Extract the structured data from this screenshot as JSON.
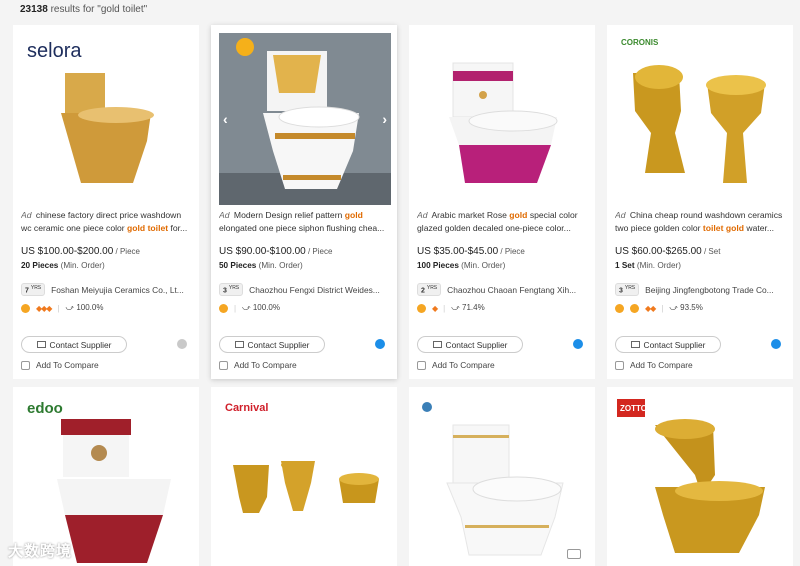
{
  "results": {
    "count": "23138",
    "text": " results for \"gold toilet\""
  },
  "colors": {
    "accent": "#e06a00",
    "chat": "#1c8ee8"
  },
  "labels": {
    "ad": "Ad",
    "contact": "Contact Supplier",
    "compare": "Add To Compare",
    "min_order": "(Min. Order)",
    "yrs_unit": "YRS"
  },
  "products": [
    {
      "brand": "selora",
      "title_pre": "chinese factory direct price washdown wc ceramic one piece color ",
      "title_hl": "gold toilet",
      "title_post": " for...",
      "price": "US $100.00-$200.00",
      "unit": " / Piece",
      "moq": "20 Pieces",
      "years": "7",
      "supplier": "Foshan Meiyujia Ceramics Co., Lt...",
      "rate": "100.0%"
    },
    {
      "brand": "",
      "title_pre": "Modern Design relief pattern ",
      "title_hl": "gold",
      "title_post": " elongated one piece siphon flushing chea...",
      "price": "US $90.00-$100.00",
      "unit": " / Piece",
      "moq": "50 Pieces",
      "years": "3",
      "supplier": "Chaozhou Fengxi District Weides...",
      "rate": "100.0%"
    },
    {
      "brand": "",
      "title_pre": "Arabic market Rose ",
      "title_hl": "gold",
      "title_post": " special color glazed golden decaled one-piece color...",
      "price": "US $35.00-$45.00",
      "unit": " / Piece",
      "moq": "100 Pieces",
      "years": "2",
      "supplier": "Chaozhou Chaoan Fengtang Xih...",
      "rate": "71.4%"
    },
    {
      "brand": "CORONIS",
      "title_pre": "China cheap round washdown ceramics two piece golden color ",
      "title_hl": "toilet gold",
      "title_post": " water...",
      "price": "US $60.00-$265.00",
      "unit": " / Set",
      "moq": "1 Set",
      "years": "3",
      "supplier": "Beijing Jingfengbotong Trade Co...",
      "rate": "93.5%"
    }
  ],
  "row2": [
    {
      "brand": "edoo"
    },
    {
      "brand": "Carnival"
    },
    {
      "brand": ""
    },
    {
      "brand": "ZOTTO"
    }
  ],
  "watermark": "大数跨境"
}
